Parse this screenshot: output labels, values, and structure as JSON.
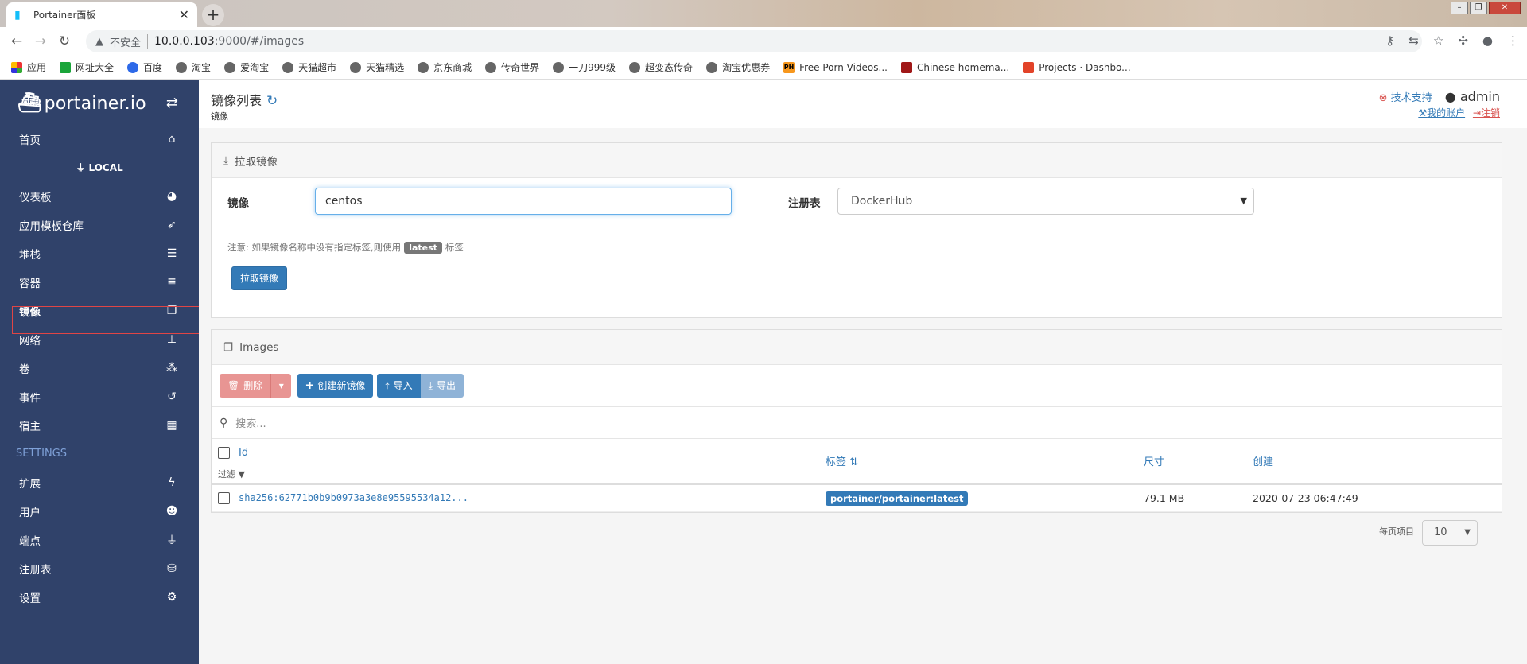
{
  "browser": {
    "tab_title": "Portainer面板",
    "insecure_label": "不安全",
    "url_host": "10.0.0.103",
    "url_rest": ":9000/#/images",
    "bookmarks": [
      "应用",
      "网址大全",
      "百度",
      "淘宝",
      "爱淘宝",
      "天猫超市",
      "天猫精选",
      "京东商城",
      "传奇世界",
      "一刀999级",
      "超变态传奇",
      "淘宝优惠券",
      "Free Porn Videos...",
      "Chinese homema...",
      "Projects · Dashbo..."
    ]
  },
  "sidebar": {
    "brand": "portainer.io",
    "home": "首页",
    "endpoint": "LOCAL",
    "items": [
      {
        "label": "仪表板",
        "icon": "dashboard-icon",
        "glyph": "◕"
      },
      {
        "label": "应用模板仓库",
        "icon": "rocket-icon",
        "glyph": "➶"
      },
      {
        "label": "堆栈",
        "icon": "list-icon",
        "glyph": "☰"
      },
      {
        "label": "容器",
        "icon": "server-icon",
        "glyph": "≣"
      },
      {
        "label": "镜像",
        "icon": "clone-icon",
        "glyph": "❐"
      },
      {
        "label": "网络",
        "icon": "sitemap-icon",
        "glyph": "⊥"
      },
      {
        "label": "卷",
        "icon": "cubes-icon",
        "glyph": "⁂"
      },
      {
        "label": "事件",
        "icon": "history-icon",
        "glyph": "↺"
      },
      {
        "label": "宿主",
        "icon": "th-icon",
        "glyph": "▦"
      }
    ],
    "settings_label": "SETTINGS",
    "settings_items": [
      {
        "label": "扩展",
        "icon": "bolt-icon",
        "glyph": "ϟ"
      },
      {
        "label": "用户",
        "icon": "users-icon",
        "glyph": "☻"
      },
      {
        "label": "端点",
        "icon": "plug-icon",
        "glyph": "⏚"
      },
      {
        "label": "注册表",
        "icon": "database-icon",
        "glyph": "⛁"
      },
      {
        "label": "设置",
        "icon": "cogs-icon",
        "glyph": "⚙"
      }
    ]
  },
  "header": {
    "title": "镜像列表",
    "breadcrumb": "镜像",
    "support": "技术支持",
    "user": "admin",
    "my_account": "我的账户",
    "logout": "注销"
  },
  "pull_panel": {
    "title": "拉取镜像",
    "image_label": "镜像",
    "image_value": "centos",
    "registry_label": "注册表",
    "registry_value": "DockerHub",
    "note_prefix": "注意: 如果镜像名称中没有指定标签,则使用",
    "note_badge": "latest",
    "note_suffix": "标签",
    "pull_button": "拉取镜像"
  },
  "images_panel": {
    "title": "Images",
    "delete_button": "删除",
    "create_button": "创建新镜像",
    "import_button": "导入",
    "export_button": "导出",
    "search_placeholder": "搜索...",
    "columns": {
      "id": "Id",
      "filter": "过滤",
      "tags": "标签",
      "size": "尺寸",
      "created": "创建"
    },
    "rows": [
      {
        "id": "sha256:62771b0b9b0973a3e8e95595534a12...",
        "tag": "portainer/portainer:latest",
        "size": "79.1 MB",
        "created": "2020-07-23 06:47:49"
      }
    ],
    "per_page_label": "每页项目",
    "per_page_value": "10"
  }
}
